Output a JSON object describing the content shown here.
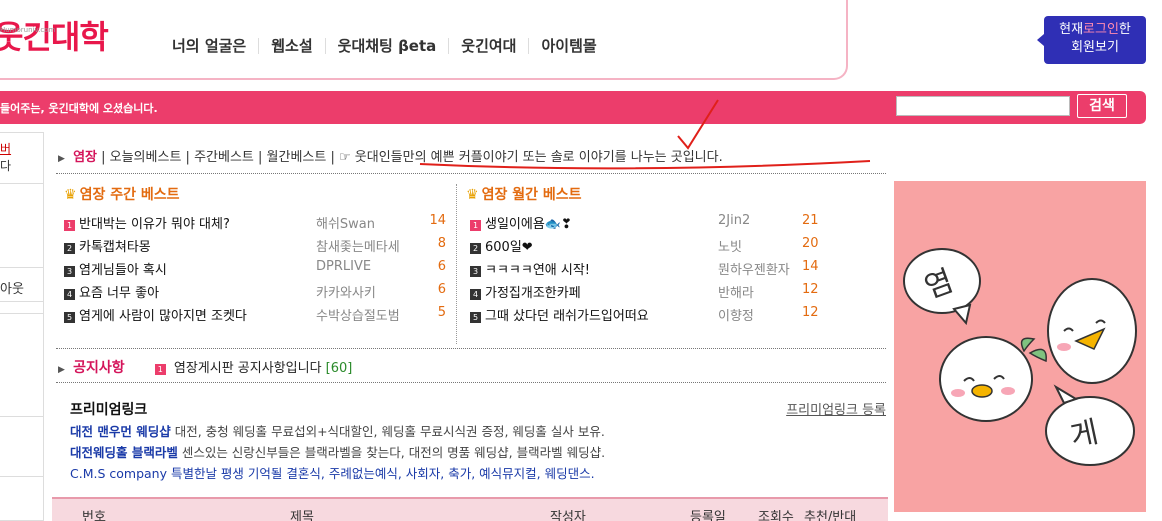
{
  "header": {
    "logo": "웃긴대학",
    "logo_small": "Humoruniv.com",
    "nav": [
      "너의 얼굴은",
      "웹소설",
      "웃대채팅 βeta",
      "웃긴여대",
      "아이템몰"
    ],
    "login_line1_a": "현재",
    "login_line1_b": "로그인",
    "login_line1_c": "한",
    "login_line2": "회원보기"
  },
  "bar": {
    "welcome": "들어주는, 웃긴대학에 오셨습니다.",
    "search_value": "",
    "search_button": "검색"
  },
  "sidebar": {
    "top_line1": "버",
    "top_line2": "다",
    "item": "아웃"
  },
  "breadcrumb": {
    "title": "염장",
    "links": [
      "오늘의베스트",
      "주간베스트",
      "월간베스트"
    ],
    "desc": "☞ 웃대인들만의 예쁜 커플이야기 또는 솔로 이야기를 나누는 곳입니다."
  },
  "weekly": {
    "heading": "염장 주간 베스트",
    "rows": [
      {
        "num": "1",
        "title": "반대박는 이유가 뭐야 대체?",
        "author": "해쉬Swan",
        "count": "14"
      },
      {
        "num": "2",
        "title": "카톡캡쳐타몽",
        "author": "참새좇는메타세",
        "count": "8"
      },
      {
        "num": "3",
        "title": "염게님들아 혹시",
        "author": "DPRLIVE",
        "count": "6"
      },
      {
        "num": "4",
        "title": "요즘 너무 좋아",
        "author": "카카와사키",
        "count": "6"
      },
      {
        "num": "5",
        "title": "염게에 사람이 많아지면 조켓다",
        "author": "수박상습절도범",
        "count": "5"
      }
    ]
  },
  "monthly": {
    "heading": "염장 월간 베스트",
    "rows": [
      {
        "num": "1",
        "title": "생일이에욤🐟❣",
        "author": "2Jin2",
        "count": "21"
      },
      {
        "num": "2",
        "title": "600일❤",
        "author": "노빗",
        "count": "20"
      },
      {
        "num": "3",
        "title": "ㅋㅋㅋㅋ연애 시작!",
        "author": "뭔하우젠환자",
        "count": "14"
      },
      {
        "num": "4",
        "title": "가정집개조한카페",
        "author": "반해라",
        "count": "12"
      },
      {
        "num": "5",
        "title": "그때 샀다던 래쉬가드입어떠요",
        "author": "이향정",
        "count": "12"
      }
    ]
  },
  "notice": {
    "label": "공지사항",
    "num": "1",
    "text": "염장게시판 공지사항입니다",
    "count": "[60]"
  },
  "premium": {
    "title": "프리미엄링크",
    "register": "프리미엄링크 등록",
    "lines": [
      {
        "name": "대전 맨우먼 웨딩샵",
        "text": " 대전, 충청 웨딩홀 무료섭외+식대할인, 웨딩홀 무료시식권 증정, 웨딩홀 실사 보유."
      },
      {
        "name": "대전웨딩홀 블랙라벨",
        "text": " 센스있는 신랑신부들은 블랙라벨을 찾는다, 대전의 명품 웨딩샵, 블랙라벨 웨딩샵."
      },
      {
        "name": "",
        "text": "C.M.S company 특별한날 평생 기억될 결혼식, 주례없는예식, 사회자, 축가, 예식뮤지컬, 웨딩댄스."
      }
    ]
  },
  "table": {
    "headers": [
      "번호",
      "제목",
      "작성자",
      "등록일",
      "조회수",
      "추천/반대"
    ]
  },
  "image": {
    "text1": "염",
    "text2": "게"
  }
}
